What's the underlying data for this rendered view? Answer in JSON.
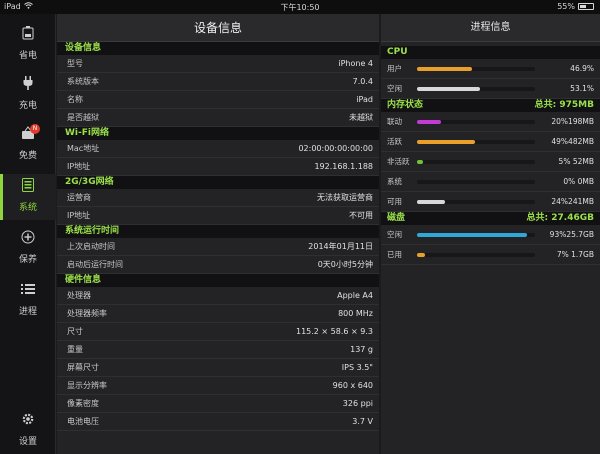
{
  "status_bar": {
    "device": "iPad",
    "time": "下午10:50",
    "battery": "55%",
    "battery_level": 0.55
  },
  "sidebar": {
    "items": [
      {
        "label": "省电",
        "icon": "battery-icon"
      },
      {
        "label": "充电",
        "icon": "plug-icon"
      },
      {
        "label": "免费",
        "icon": "gift-icon",
        "badge": "N"
      },
      {
        "label": "系统",
        "icon": "system-icon",
        "active": true
      },
      {
        "label": "保养",
        "icon": "plus-circle-icon"
      },
      {
        "label": "进程",
        "icon": "list-icon"
      },
      {
        "label": "设置",
        "icon": "gear-icon"
      }
    ]
  },
  "device_panel": {
    "title": "设备信息",
    "sections": [
      {
        "title": "设备信息",
        "rows": [
          {
            "k": "型号",
            "v": "iPhone 4"
          },
          {
            "k": "系统版本",
            "v": "7.0.4"
          },
          {
            "k": "名称",
            "v": "iPad"
          },
          {
            "k": "是否越狱",
            "v": "未越狱"
          }
        ]
      },
      {
        "title": "Wi-Fi网络",
        "rows": [
          {
            "k": "Mac地址",
            "v": "02:00:00:00:00:00"
          },
          {
            "k": "IP地址",
            "v": "192.168.1.188"
          }
        ]
      },
      {
        "title": "2G/3G网络",
        "rows": [
          {
            "k": "运营商",
            "v": "无法获取运营商"
          },
          {
            "k": "IP地址",
            "v": "不可用"
          }
        ]
      },
      {
        "title": "系统运行时间",
        "rows": [
          {
            "k": "上次启动时间",
            "v": "2014年01月11日"
          },
          {
            "k": "启动后运行时间",
            "v": "0天0小时5分钟"
          }
        ]
      },
      {
        "title": "硬件信息",
        "rows": [
          {
            "k": "处理器",
            "v": "Apple A4"
          },
          {
            "k": "处理器频率",
            "v": "800 MHz"
          },
          {
            "k": "尺寸",
            "v": "115.2 × 58.6 × 9.3"
          },
          {
            "k": "重量",
            "v": "137 g"
          },
          {
            "k": "屏幕尺寸",
            "v": "IPS 3.5\""
          },
          {
            "k": "显示分辨率",
            "v": "960 x 640"
          },
          {
            "k": "像素密度",
            "v": "326 ppi"
          },
          {
            "k": "电池电压",
            "v": "3.7 V"
          }
        ]
      }
    ]
  },
  "process_panel": {
    "title": "进程信息",
    "cpu": {
      "title": "CPU",
      "rows": [
        {
          "k": "用户",
          "v": "46.9%",
          "level": 0.469,
          "color": "#e8a02a"
        },
        {
          "k": "空闲",
          "v": "53.1%",
          "level": 0.531,
          "color": "#d8d8d8"
        }
      ]
    },
    "memory": {
      "title": "内存状态",
      "total": "总共: 975MB",
      "rows": [
        {
          "k": "联动",
          "v": "20%198MB",
          "level": 0.2,
          "color": "#c23bd4"
        },
        {
          "k": "活跃",
          "v": "49%482MB",
          "level": 0.49,
          "color": "#e8a02a"
        },
        {
          "k": "非活跃",
          "v": "5%  52MB",
          "level": 0.05,
          "color": "#6fc23a"
        },
        {
          "k": "系统",
          "v": "0%   0MB",
          "level": 0.0,
          "color": "#888888"
        },
        {
          "k": "可用",
          "v": "24%241MB",
          "level": 0.24,
          "color": "#d8d8d8"
        }
      ]
    },
    "disk": {
      "title": "磁盘",
      "total": "总共: 27.46GB",
      "rows": [
        {
          "k": "空闲",
          "v": "93%25.7GB",
          "level": 0.93,
          "color": "#2fa8d8"
        },
        {
          "k": "已用",
          "v": "7% 1.7GB",
          "level": 0.07,
          "color": "#e8a02a"
        }
      ]
    }
  }
}
